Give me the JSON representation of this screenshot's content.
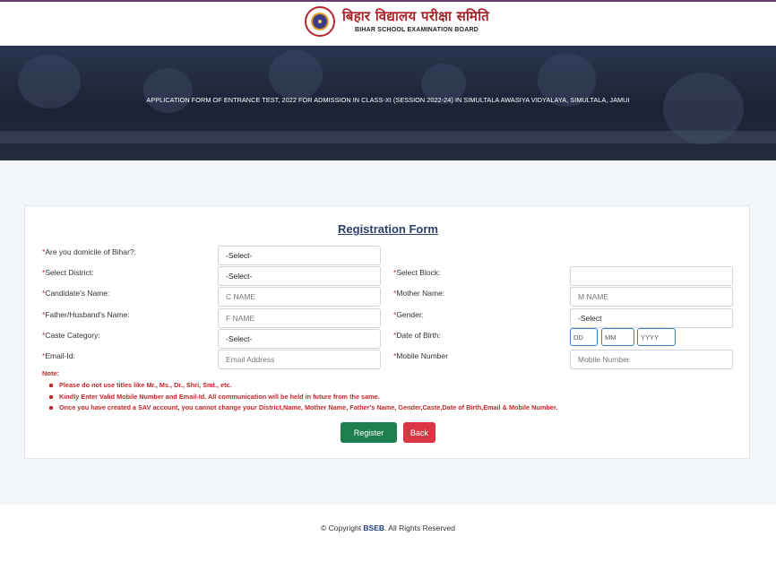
{
  "header": {
    "logo_hindi": "बिहार विद्यालय परीक्षा समिति",
    "logo_english": "BIHAR SCHOOL EXAMINATION BOARD"
  },
  "banner": {
    "title": "APPLICATION FORM OF ENTRANCE TEST, 2022 FOR ADMISSION IN CLASS-XI (SESSION 2022-24) IN SIMULTALA AWASIYA VIDYALAYA, SIMULTALA, JAMUI"
  },
  "form": {
    "title": "Registration Form",
    "domicile": {
      "label": "Are you domicile of Bihar?:",
      "value": "-Select-"
    },
    "district": {
      "label": "Select District:",
      "value": "-Select-"
    },
    "block": {
      "label": "Select Block:",
      "value": ""
    },
    "candidate_name": {
      "label": "Candidate's Name:",
      "placeholder": "C NAME"
    },
    "mother_name": {
      "label": "Mother Name:",
      "placeholder": "M NAME"
    },
    "father_name": {
      "label": "Father/Husband's Name:",
      "placeholder": "F NAME"
    },
    "gender": {
      "label": "Gender:",
      "value": "-Select"
    },
    "caste": {
      "label": "Caste Category:",
      "value": "-Select-"
    },
    "dob": {
      "label": "Date of Birth:",
      "dd": "DD",
      "mm": "MM",
      "yyyy": "YYYY"
    },
    "email": {
      "label": "Email-Id:",
      "placeholder": "Email Address"
    },
    "mobile": {
      "label": "Mobile Number",
      "placeholder": "Mobile Number"
    },
    "required_mark": "*",
    "note_title": "Note:",
    "notes": [
      "Please do not use titles like Mr., Ms., Dr., Shri, Smt., etc.",
      "Kindly Enter Valid Mobile Number and Email-Id. All communication will be held in future from the same.",
      "Once you have created a SAV account, you cannot change your District,Name, Mother Name, Father's Name, Gender,Caste,Date of Birth,Email & Mobile Number."
    ],
    "register_label": "Register",
    "back_label": "Back"
  },
  "footer": {
    "copyright_prefix": "© Copyright ",
    "brand": "BSEB",
    "copyright_suffix": ". All Rights Reserved"
  },
  "colors": {
    "accent": "#2c3e6b",
    "note_red": "#c0292b",
    "register_green": "#1e7e4e",
    "back_red": "#dc3545"
  }
}
